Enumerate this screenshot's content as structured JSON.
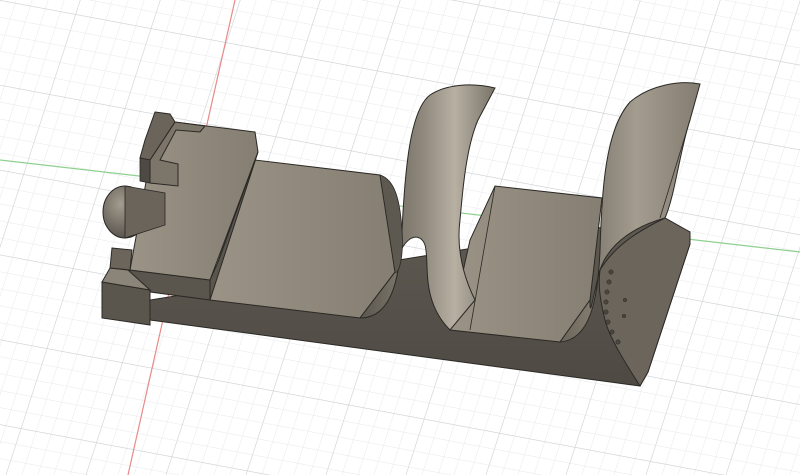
{
  "viewport": {
    "background": "#ffffff",
    "grid_minor_color": "#e6e8ea",
    "grid_major_color": "#cfd3d7",
    "x_axis_color": "#e88a8a",
    "y_axis_color": "#8fd08f"
  },
  "model": {
    "body_color": "#6f6a62",
    "top_color": "#8b8478",
    "shadow_color": "#4f4a43",
    "highlight_color": "#b3ac9f",
    "edge_color": "#2b2925"
  }
}
